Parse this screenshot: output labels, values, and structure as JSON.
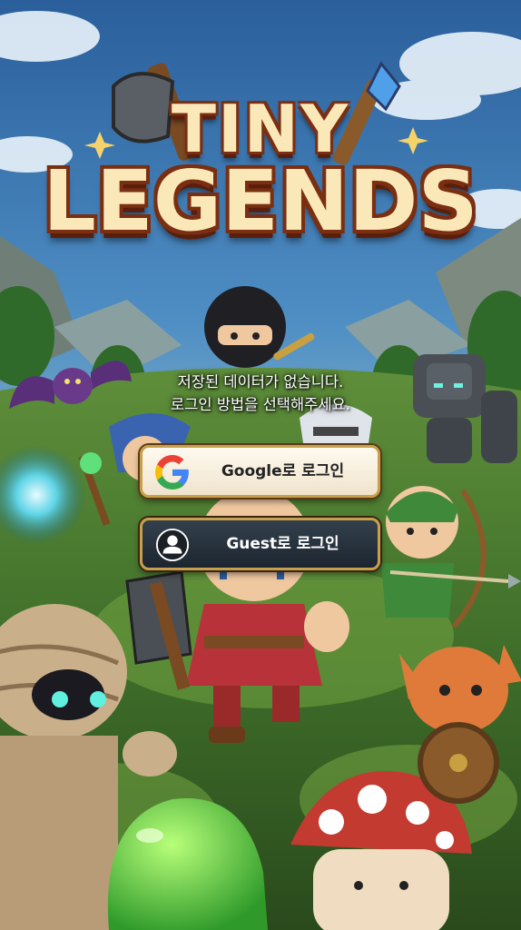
{
  "logo": {
    "line1": "TINY",
    "line2": "LEGENDS"
  },
  "message": {
    "line1": "저장된 데이터가 없습니다.",
    "line2": "로그인 방법을 선택해주세요."
  },
  "buttons": {
    "google_label": "Google로 로그인",
    "guest_label": "Guest로 로그인"
  },
  "icons": {
    "google": "google-logo-icon",
    "guest": "person-icon"
  },
  "colors": {
    "logo_text": "#fbe8b8",
    "logo_outline": "#7a2e12",
    "button_border": "#c7a04e",
    "google_button_bg": "#fffaf0",
    "guest_button_bg": "#1d2630"
  }
}
